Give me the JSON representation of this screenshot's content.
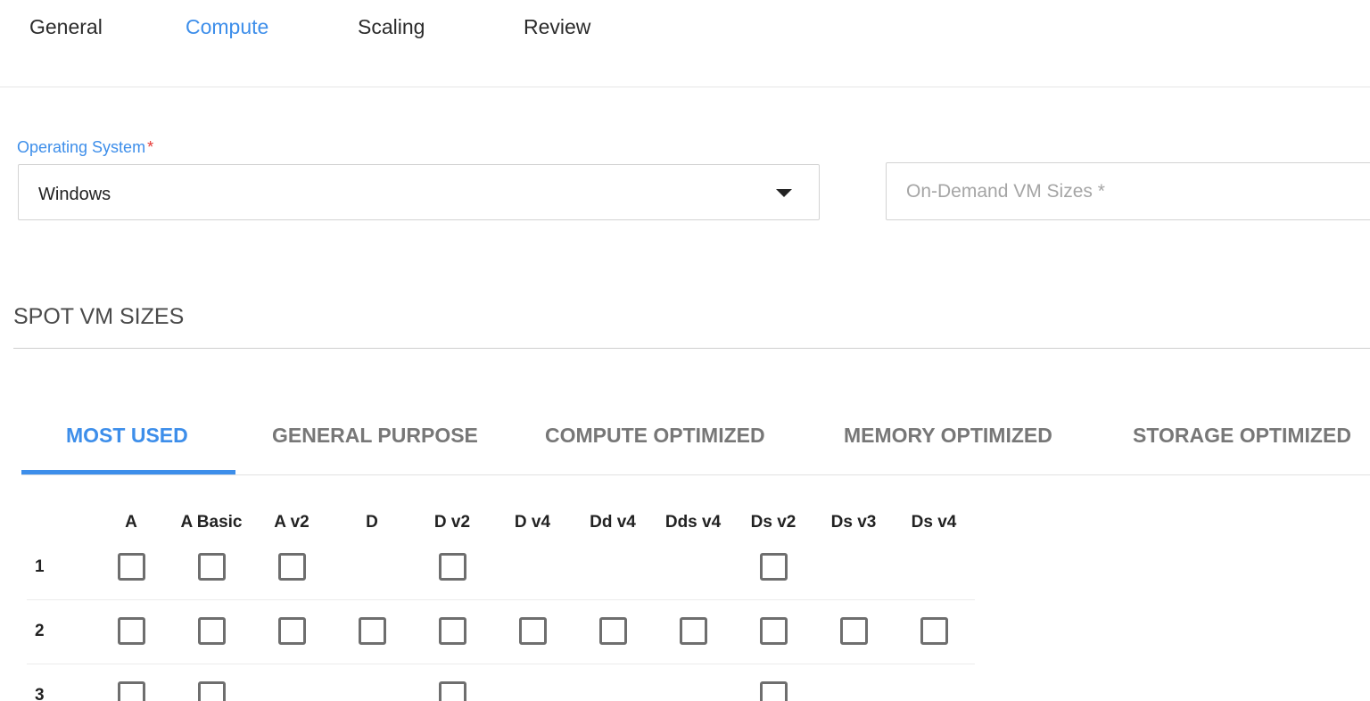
{
  "steps": [
    "General",
    "Compute",
    "Scaling",
    "Review"
  ],
  "active_step": 1,
  "os": {
    "label": "Operating System",
    "required_mark": "*",
    "value": "Windows"
  },
  "on_demand": {
    "placeholder": "On-Demand VM Sizes *"
  },
  "spot": {
    "title": "SPOT VM SIZES"
  },
  "tabs": [
    "MOST USED",
    "GENERAL PURPOSE",
    "COMPUTE OPTIMIZED",
    "MEMORY OPTIMIZED",
    "STORAGE OPTIMIZED"
  ],
  "active_tab": 0,
  "grid": {
    "columns": [
      "A",
      "A Basic",
      "A v2",
      "D",
      "D v2",
      "D v4",
      "Dd v4",
      "Dds v4",
      "Ds v2",
      "Ds v3",
      "Ds v4"
    ],
    "rows": [
      {
        "label": "1",
        "available": [
          true,
          true,
          true,
          false,
          true,
          false,
          false,
          false,
          true,
          false,
          false
        ]
      },
      {
        "label": "2",
        "available": [
          true,
          true,
          true,
          true,
          true,
          true,
          true,
          true,
          true,
          true,
          true
        ]
      },
      {
        "label": "3",
        "available": [
          true,
          true,
          false,
          false,
          true,
          false,
          false,
          false,
          true,
          false,
          false
        ]
      }
    ]
  },
  "colors": {
    "accent": "#3d8eea",
    "required": "#e53935"
  }
}
